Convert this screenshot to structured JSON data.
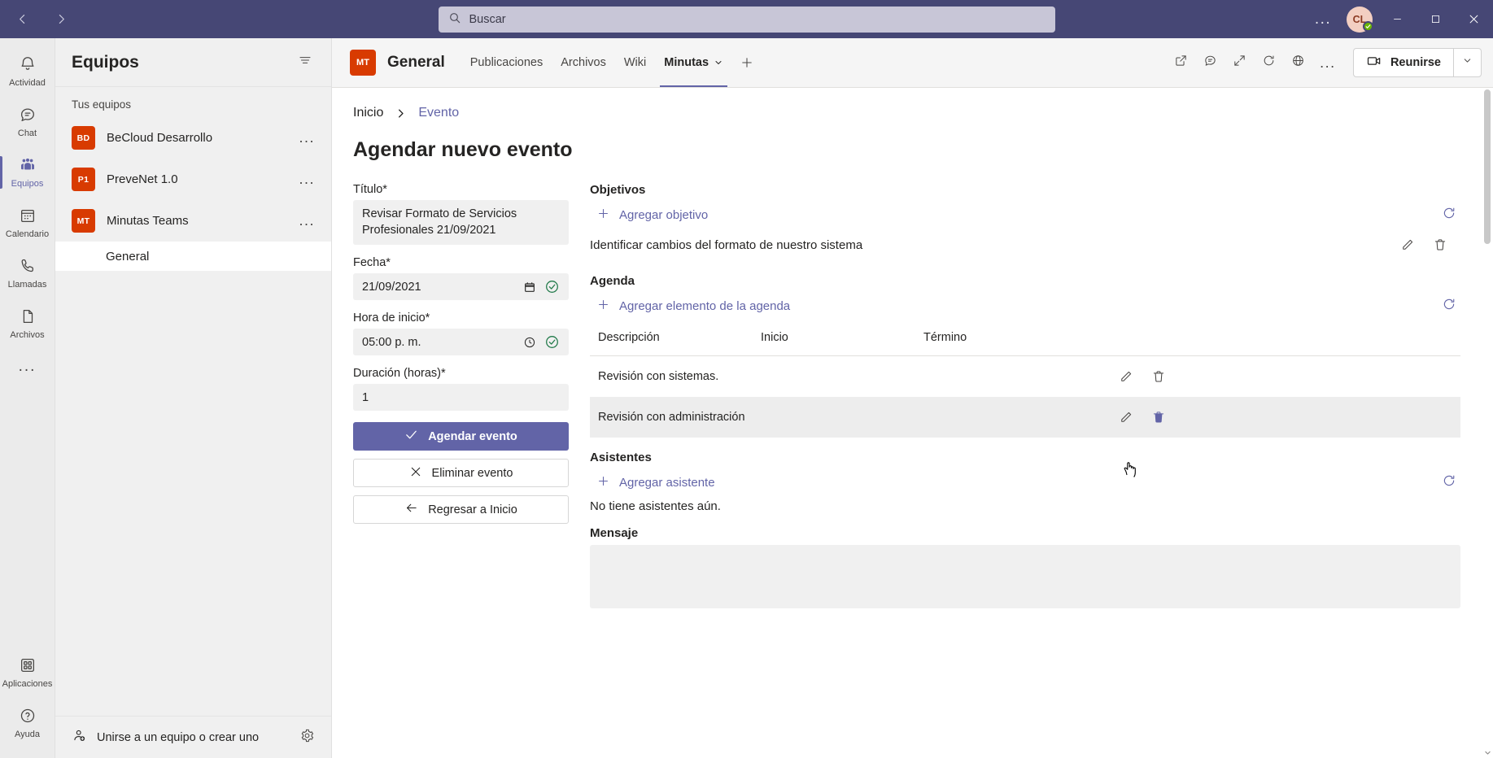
{
  "titlebar": {
    "back_label": "Atrás",
    "forward_label": "Adelante",
    "search_placeholder": "Buscar",
    "more_label": "...",
    "avatar_initials": "CL",
    "minimize_label": "Minimizar",
    "maximize_label": "Maximizar",
    "close_label": "Cerrar"
  },
  "rail": {
    "items": [
      {
        "label": "Actividad",
        "icon": "bell-icon",
        "active": false
      },
      {
        "label": "Chat",
        "icon": "chat-icon",
        "active": false
      },
      {
        "label": "Equipos",
        "icon": "teams-icon",
        "active": true
      },
      {
        "label": "Calendario",
        "icon": "calendar-icon",
        "active": false
      },
      {
        "label": "Llamadas",
        "icon": "phone-icon",
        "active": false
      },
      {
        "label": "Archivos",
        "icon": "file-icon",
        "active": false
      }
    ],
    "more_label": "...",
    "bottom": [
      {
        "label": "Aplicaciones",
        "icon": "apps-icon"
      },
      {
        "label": "Ayuda",
        "icon": "help-icon"
      }
    ]
  },
  "sidebar": {
    "title": "Equipos",
    "filter_label": "Filtrar",
    "section_label": "Tus equipos",
    "teams": [
      {
        "initials": "BD",
        "name": "BeCloud Desarrollo",
        "color": "#d83b01",
        "more": "..."
      },
      {
        "initials": "P1",
        "name": "PreveNet 1.0",
        "color": "#d83b01",
        "more": "..."
      },
      {
        "initials": "MT",
        "name": "Minutas Teams",
        "color": "#d83b01",
        "more": "..."
      }
    ],
    "channel": "General",
    "join_label": "Unirse a un equipo o crear uno",
    "settings_label": "Administrar equipos"
  },
  "main_header": {
    "team_initials": "MT",
    "channel_title": "General",
    "tabs": [
      {
        "label": "Publicaciones",
        "active": false,
        "chevron": false
      },
      {
        "label": "Archivos",
        "active": false,
        "chevron": false
      },
      {
        "label": "Wiki",
        "active": false,
        "chevron": false
      },
      {
        "label": "Minutas",
        "active": true,
        "chevron": true
      }
    ],
    "add_tab_label": "+",
    "icons": [
      {
        "name": "open-in-new-window-icon"
      },
      {
        "name": "chat-bubble-icon"
      },
      {
        "name": "expand-icon"
      },
      {
        "name": "refresh-icon"
      },
      {
        "name": "globe-icon"
      }
    ],
    "more_label": "...",
    "meet_label": "Reunirse",
    "meet_dropdown_label": "Opciones de reunión"
  },
  "content": {
    "breadcrumb": [
      {
        "label": "Inicio",
        "current": false
      },
      {
        "label": "Evento",
        "current": true
      }
    ],
    "page_title": "Agendar nuevo evento",
    "form": {
      "title_label": "Título*",
      "title_value": "Revisar Formato de Servicios Profesionales 21/09/2021",
      "date_label": "Fecha*",
      "date_value": "21/09/2021",
      "time_label": "Hora de inicio*",
      "time_value": "05:00 p. m.",
      "duration_label": "Duración (horas)*",
      "duration_value": "1",
      "submit_label": "Agendar evento",
      "delete_label": "Eliminar evento",
      "back_label": "Regresar a Inicio"
    },
    "objectives": {
      "title": "Objetivos",
      "add_label": "Agregar objetivo",
      "refresh_label": "Actualizar",
      "items": [
        {
          "text": "Identificar cambios del formato de nuestro sistema",
          "edit": "Editar",
          "delete": "Eliminar"
        }
      ]
    },
    "agenda": {
      "title": "Agenda",
      "add_label": "Agregar elemento de la agenda",
      "refresh_label": "Actualizar",
      "columns": [
        "Descripción",
        "Inicio",
        "Término"
      ],
      "rows": [
        {
          "descripcion": "Revisión con sistemas.",
          "inicio": "",
          "termino": "",
          "hovered": false
        },
        {
          "descripcion": "Revisión con administración",
          "inicio": "",
          "termino": "",
          "hovered": true
        }
      ]
    },
    "attendees": {
      "title": "Asistentes",
      "add_label": "Agregar asistente",
      "refresh_label": "Actualizar",
      "empty_text": "No tiene asistentes aún."
    },
    "message": {
      "title": "Mensaje",
      "value": ""
    }
  },
  "colors": {
    "brand_purple": "#6264a7",
    "titlebar_purple": "#464775",
    "team_orange": "#d83b01",
    "success_green": "#237b4b",
    "presence_green": "#6bb700"
  }
}
